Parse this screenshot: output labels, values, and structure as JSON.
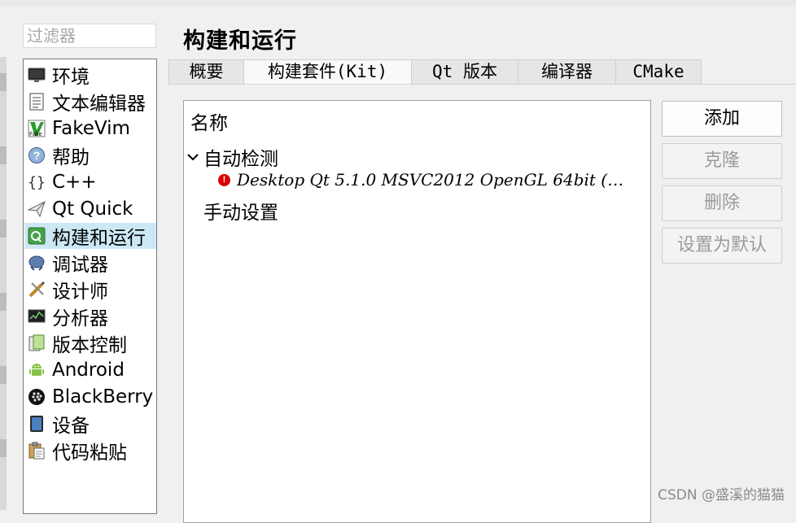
{
  "filter": {
    "placeholder": "过滤器"
  },
  "sidebar": {
    "items": [
      {
        "label": "环境",
        "icon": "monitor-icon"
      },
      {
        "label": "文本编辑器",
        "icon": "text-document-icon"
      },
      {
        "label": "FakeVim",
        "icon": "fakevim-icon"
      },
      {
        "label": "帮助",
        "icon": "help-icon"
      },
      {
        "label": "C++",
        "icon": "braces-icon"
      },
      {
        "label": "Qt Quick",
        "icon": "paper-plane-icon"
      },
      {
        "label": "构建和运行",
        "icon": "qt-build-icon",
        "selected": true
      },
      {
        "label": "调试器",
        "icon": "bug-icon"
      },
      {
        "label": "设计师",
        "icon": "designer-tools-icon"
      },
      {
        "label": "分析器",
        "icon": "analyzer-chart-icon"
      },
      {
        "label": "版本控制",
        "icon": "version-control-icon"
      },
      {
        "label": "Android",
        "icon": "android-icon"
      },
      {
        "label": "BlackBerry",
        "icon": "blackberry-icon"
      },
      {
        "label": "设备",
        "icon": "tablet-device-icon"
      },
      {
        "label": "代码粘贴",
        "icon": "clipboard-icon"
      }
    ]
  },
  "page": {
    "title": "构建和运行"
  },
  "tabs": [
    {
      "label": "概要"
    },
    {
      "label": "构建套件(Kit)",
      "active": true
    },
    {
      "label": "Qt 版本"
    },
    {
      "label": "编译器"
    },
    {
      "label": "CMake"
    }
  ],
  "tree": {
    "header": "名称",
    "auto_group": "自动检测",
    "manual_group": "手动设置",
    "kit_label": "Desktop Qt 5.1.0 MSVC2012 OpenGL 64bit (…"
  },
  "buttons": {
    "add": "添加",
    "clone": "克隆",
    "remove": "删除",
    "make_default": "设置为默认"
  },
  "watermark": "CSDN @盛溪的猫猫",
  "colors": {
    "selection": "#cde8f5",
    "error": "#d80000",
    "disabled_text": "#9a9a9a"
  }
}
